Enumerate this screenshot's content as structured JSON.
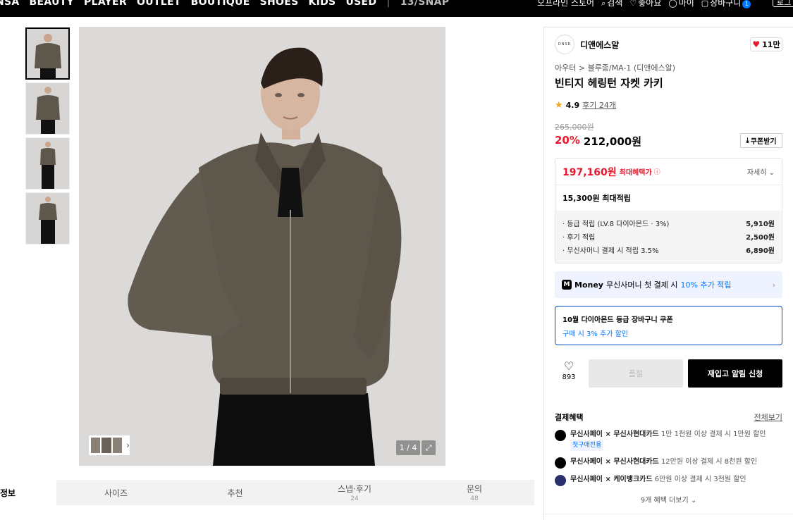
{
  "topnav": {
    "categories": [
      "NSA",
      "BEAUTY",
      "PLAYER",
      "OUTLET",
      "BOUTIQUE",
      "SHOES",
      "KIDS",
      "USED",
      "|",
      "13/SNAP"
    ],
    "util": {
      "offline": "오프라인 스토어",
      "search": "검색",
      "like": "좋아요",
      "mypage": "마이",
      "cart": "장바구니",
      "cart_count": "1"
    },
    "login": "로그"
  },
  "gallery": {
    "counter": "1 / 4",
    "expand_icon": "expand-icon"
  },
  "tabs": [
    {
      "label": "정보",
      "sub": ""
    },
    {
      "label": "사이즈",
      "sub": ""
    },
    {
      "label": "추천",
      "sub": ""
    },
    {
      "label": "스냅·후기",
      "sub": "24"
    },
    {
      "label": "문의",
      "sub": "48"
    }
  ],
  "product": {
    "brand_logo": "DNSR",
    "brand_name": "디앤에스알",
    "likes": "11만",
    "breadcrumb": "아우터 > 블루종/MA-1 (디앤에스알)",
    "title": "빈티지 헤링턴 자켓 카키",
    "rating": "4.9",
    "reviews": "후기 24개",
    "original_price": "265,000원",
    "discount": "20%",
    "price": "212,000원",
    "coupon_button": "쿠폰받기"
  },
  "benefit": {
    "max_price": "197,160원",
    "max_label": "최대혜택가",
    "detail": "자세히",
    "points_total": "15,300원 최대적립",
    "rows": [
      {
        "label": "· 등급 적립 (LV.8 다이아몬드 · 3%)",
        "value": "5,910원"
      },
      {
        "label": "· 후기 적립",
        "value": "2,500원"
      },
      {
        "label": "· 무신사머니 결제 시 적립 3.5%",
        "value": "6,890원"
      }
    ]
  },
  "money": {
    "label": "Money",
    "text": "무신사머니 첫 결제 시",
    "highlight": "10% 추가 적립"
  },
  "coupon_box": {
    "title": "10월 다이아몬드 등급 장바구니 쿠폰",
    "sub": "구매 시 3% 추가 할인"
  },
  "actions": {
    "wish_count": "893",
    "soldout": "품절",
    "restock": "재입고 알림 신청"
  },
  "payment": {
    "title": "결제혜택",
    "all": "전체보기",
    "items": [
      {
        "name": "무신사페이 × 무신사현대카드",
        "desc": "1만 1천원 이상 결제 시 1만원 할인",
        "tag": "첫구매전용"
      },
      {
        "name": "무신사페이 × 무신사현대카드",
        "desc": "12만원 이상 결제 시 8천원 할인",
        "tag": ""
      },
      {
        "name": "무신사페이 × 케이뱅크카드",
        "desc": "6만원 이상 결제 시 3천원 할인",
        "tag": ""
      }
    ],
    "more": "9개 혜택 더보기"
  },
  "colors": {
    "accent_red": "#e8192c",
    "accent_blue": "#0078ff",
    "jacket": "#5e574c"
  }
}
